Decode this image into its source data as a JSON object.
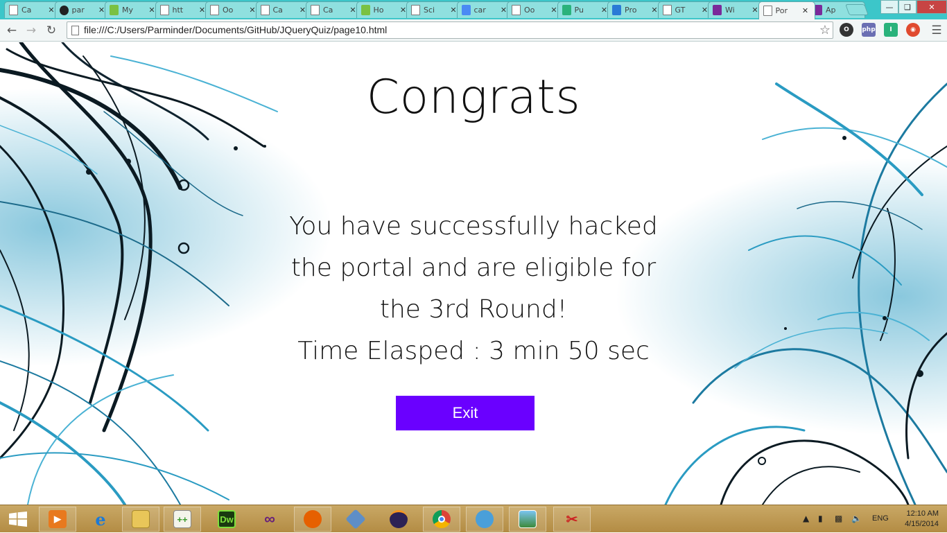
{
  "browser": {
    "tabs": [
      {
        "label": "Ca",
        "icon": "doc"
      },
      {
        "label": "par",
        "icon": "gh"
      },
      {
        "label": "My",
        "icon": "grn"
      },
      {
        "label": "htt",
        "icon": "doc"
      },
      {
        "label": "Oo",
        "icon": "doc"
      },
      {
        "label": "Ca",
        "icon": "doc"
      },
      {
        "label": "Ca",
        "icon": "doc"
      },
      {
        "label": "Ho",
        "icon": "grn"
      },
      {
        "label": "Sci",
        "icon": "doc"
      },
      {
        "label": "car",
        "icon": "goog"
      },
      {
        "label": "Oo",
        "icon": "doc"
      },
      {
        "label": "Pu",
        "icon": "pb"
      },
      {
        "label": "Pro",
        "icon": "db"
      },
      {
        "label": "GT",
        "icon": "doc"
      },
      {
        "label": "Wi",
        "icon": "win"
      },
      {
        "label": "Por",
        "icon": "doc",
        "active": true
      },
      {
        "label": "Ap",
        "icon": "win"
      }
    ],
    "url": "file:///C:/Users/Parminder/Documents/GitHub/JQueryQuiz/page10.html",
    "extensions": [
      "opera-icon",
      "php-icon",
      "pushbullet-icon",
      "chrome-icon"
    ]
  },
  "page": {
    "title": "Congrats",
    "message": "You have successfully hacked the portal and are eligible for the 3rd Round!",
    "time_label": "Time Elasped : 3 min 50 sec",
    "exit_label": "Exit"
  },
  "taskbar": {
    "apps": [
      "media-player",
      "internet-explorer",
      "file-explorer",
      "notepad-plus-plus",
      "dreamweaver",
      "visual-studio",
      "firefox",
      "virtualbox",
      "eclipse",
      "chrome",
      "github-for-windows",
      "photo-viewer",
      "snipping-tool"
    ],
    "dreamweaver_label": "Dw",
    "lang": "ENG",
    "time": "12:10 AM",
    "date": "4/15/2014"
  },
  "colors": {
    "accent_button": "#6a00ff",
    "tabstrip": "#3cc6c9",
    "taskbar": "#c9a865"
  }
}
